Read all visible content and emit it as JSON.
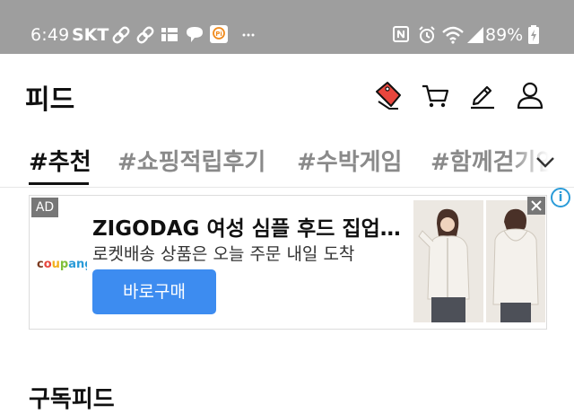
{
  "status_bar": {
    "time": "6:49",
    "carrier": "SKT",
    "battery_percent": "89%",
    "icons": [
      "link-icon",
      "link-icon",
      "app-grid-icon",
      "chat-bubble-icon",
      "pi-app-icon",
      "more-dots-icon",
      "nfc-icon",
      "alarm-icon",
      "wifi-icon",
      "signal-icon",
      "battery-charging-icon"
    ]
  },
  "header": {
    "title": "피드",
    "icons": [
      "coupon-tag-icon",
      "cart-icon",
      "write-icon",
      "profile-icon"
    ]
  },
  "tabs": [
    {
      "label": "#추천",
      "active": true
    },
    {
      "label": "#쇼핑적립후기",
      "active": false
    },
    {
      "label": "#수박게임",
      "active": false
    },
    {
      "label": "#함께걷기인증",
      "active": false
    }
  ],
  "tabs_expand_icon": "chevron-down-icon",
  "ad": {
    "badge": "AD",
    "brand": "coupang",
    "title": "ZIGODAG  여성 심플 후드 집업 자켓",
    "subtitle": "로켓배송 상품은 오늘 주문 내일 도착",
    "cta": "바로구매",
    "close_icon": "close-icon",
    "info_icon": "info-icon",
    "images": [
      "product-image-front",
      "product-image-back"
    ]
  },
  "next_section_title": "구독피드",
  "colors": {
    "status_bar_bg": "#9e9e9e",
    "cta_blue": "#3d8cf0",
    "tab_inactive": "#8a8a8a",
    "coupon_red": "#e8463d"
  }
}
